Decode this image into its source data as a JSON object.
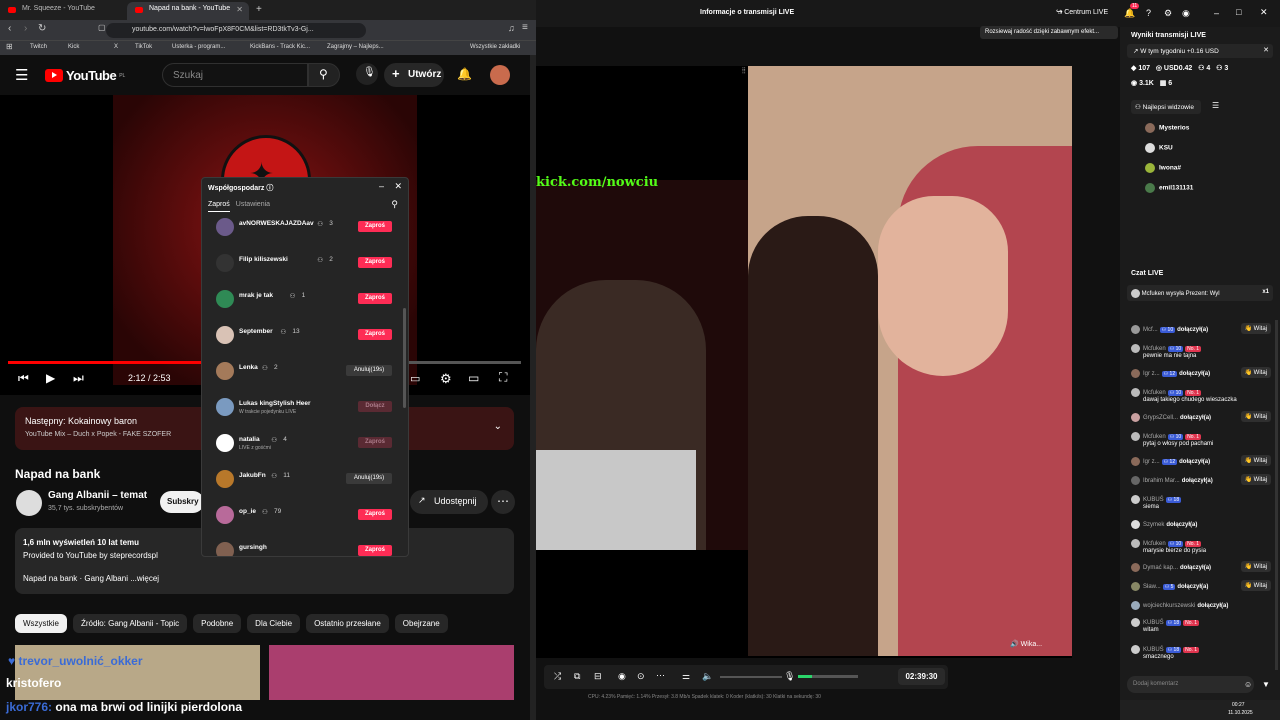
{
  "browser": {
    "tabs": [
      {
        "title": "Mr. Squeeze - YouTube",
        "active": false
      },
      {
        "title": "Napad na bank - YouTube",
        "active": true
      }
    ],
    "url": "youtube.com/watch?v=lwoFpX8F0CM&list=RD3tkTv3-Gj...",
    "bookmarks": [
      "Twitch",
      "Kick",
      "X",
      "TikTok",
      "Usterka - program...",
      "KickBans - Track Kic...",
      "Zagrajmy – Najleps...",
      "Wszystkie zakładki"
    ]
  },
  "youtube": {
    "logo": "YouTube",
    "logo_region": "PL",
    "search_placeholder": "Szukaj",
    "create_label": "Utwórz",
    "timecode": "2:12 / 2:53",
    "progress_fraction": 0.76,
    "next_up_title": "Następny: Kokainowy baron",
    "next_up_sub": "YouTube Mix – Duch x Popek - FAKE SZOFER",
    "video_title": "Napad na bank",
    "channel_name": "Gang Albanii – temat",
    "subscribers": "35,7 tys. subskrybentów",
    "subscribe_label": "Subskry",
    "share_label": "Udostępnij",
    "more_label": "⋯",
    "desc_line1": "1,6 mln wyświetleń  10 lat temu",
    "desc_line2": "Provided to YouTube by steprecordspl",
    "desc_line3": "Napad na bank · Gang Albani ...więcej",
    "chips": [
      "Wszystkie",
      "Źródło: Gang Albanii - Topic",
      "Podobne",
      "Dla Ciebie",
      "Ostatnio przesłane",
      "Obejrzane"
    ]
  },
  "cohost": {
    "title": "Współgospodarz ⓘ",
    "tab_invite": "Zaproś",
    "tab_settings": "Ustawienia",
    "rows": [
      {
        "name": "avNORWESKAJAZDAav",
        "count": "3",
        "sub": "",
        "button": "Zaproś",
        "style": "red"
      },
      {
        "name": "Filip kiliszewski",
        "count": "2",
        "sub": "",
        "button": "Zaproś",
        "style": "red"
      },
      {
        "name": "mrak je tak",
        "count": "1",
        "sub": "",
        "button": "Zaproś",
        "style": "red"
      },
      {
        "name": "September",
        "count": "13",
        "sub": "",
        "button": "Zaproś",
        "style": "red"
      },
      {
        "name": "Lenka",
        "count": "2",
        "sub": "",
        "button": "Anuluj(19s)",
        "style": "gray"
      },
      {
        "name": "Lukas kingStylish Heer",
        "count": "",
        "sub": "W trakcie pojedynku LIVE",
        "button": "Dołącz",
        "style": "dim"
      },
      {
        "name": "natalia",
        "count": "4",
        "sub": "LIVE z gośćmi",
        "button": "Zaproś",
        "style": "dim"
      },
      {
        "name": "JakubFn",
        "count": "11",
        "sub": "",
        "button": "Anuluj(19s)",
        "style": "gray"
      },
      {
        "name": "op_ie",
        "count": "79",
        "sub": "",
        "button": "Zaproś",
        "style": "red"
      },
      {
        "name": "gursingh",
        "count": "",
        "sub": "",
        "button": "Zaproś",
        "style": "red"
      }
    ]
  },
  "live": {
    "header_title": "Informacje o transmisji LIVE",
    "centrum": "Centrum LIVE",
    "notif_count": "11",
    "gift_banner": "Rozsiewaj radość dzięki zabawnym efekt...",
    "kick_overlay": "kick.com/nowciu",
    "time": "02:39:30",
    "overlay_name": "Wika...",
    "stats": "CPU: 4.23%   Pamięć: 1.14%   Przesył: 3.8 Mb/s   Spadek klatek: 0   Koder (klatki/s): 30   Klatki na sekundę: 30"
  },
  "results": {
    "title": "Wyniki transmisji LIVE",
    "week": "W tym tygodniu +0.16 USD",
    "stat_coins": "107",
    "stat_usd": "USD0.42",
    "stat_users": "4",
    "stat_follows": "3",
    "stat_viewers": "3.1K",
    "stat_gifts": "6",
    "top_viewers_label": "Najlepsi widzowie",
    "top_viewers": [
      "Mysterios",
      "KSU",
      "Iwona#",
      "emil131131"
    ]
  },
  "chat": {
    "title": "Czat LIVE",
    "gift_line": "Mcfuken wysyła Prezent: Wyl",
    "gift_count": "x1",
    "messages": [
      {
        "user": "Mcf...",
        "lvl": "10",
        "fan": "",
        "text": "dołączył(a)",
        "welcome": true
      },
      {
        "user": "Mcfuken",
        "lvl": "10",
        "fan": "No. 1",
        "text": "pewnie ma nie tajna",
        "welcome": false
      },
      {
        "user": "Igr z...",
        "lvl": "12",
        "fan": "",
        "text": "dołączył(a)",
        "welcome": true
      },
      {
        "user": "Mcfuken",
        "lvl": "10",
        "fan": "No. 1",
        "text": "dawaj takiego chudego wieszaczka",
        "welcome": false
      },
      {
        "user": "GrypsZCell...",
        "lvl": "",
        "fan": "",
        "text": "dołączył(a)",
        "welcome": true
      },
      {
        "user": "Mcfuken",
        "lvl": "10",
        "fan": "No. 1",
        "text": "pytaj o włosy pod pachami",
        "welcome": false
      },
      {
        "user": "Igr z...",
        "lvl": "12",
        "fan": "",
        "text": "dołączył(a)",
        "welcome": true
      },
      {
        "user": "Ibrahim Mar...",
        "lvl": "",
        "fan": "",
        "text": "dołączył(a)",
        "welcome": true
      },
      {
        "user": "KUBUŚ",
        "lvl": "18",
        "fan": "",
        "text": "siema",
        "welcome": false
      },
      {
        "user": "Szymek",
        "lvl": "",
        "fan": "",
        "text": "dołączył(a)",
        "welcome": false
      },
      {
        "user": "Mcfuken",
        "lvl": "10",
        "fan": "No. 1",
        "text": "marysie bierze do pysia",
        "welcome": false
      },
      {
        "user": "Dymać kap...",
        "lvl": "",
        "fan": "",
        "text": "dołączył(a)",
        "welcome": true
      },
      {
        "user": "Sław...",
        "lvl": "5",
        "fan": "",
        "text": "dołączył(a)",
        "welcome": true
      },
      {
        "user": "wojciechkurszewski",
        "lvl": "",
        "fan": "",
        "text": "dołączył(a)",
        "welcome": false
      },
      {
        "user": "KUBUŚ",
        "lvl": "18",
        "fan": "No. 1",
        "text": "witam",
        "welcome": false
      },
      {
        "user": "KUBUŚ",
        "lvl": "18",
        "fan": "No. 1",
        "text": "smacznego",
        "welcome": false
      }
    ],
    "welcome_label": "Witaj",
    "comment_placeholder": "Dodaj komentarz"
  },
  "overlay_chat": {
    "line1": "trevor_uwolnić_okker",
    "line2": "kristofero",
    "line3_user": "jkor776:",
    "line3_text": "ona ma brwi od linijki pierdolona"
  },
  "taskbar": {
    "time": "00:27",
    "date": "11.10.2025"
  },
  "colors": {
    "youtube_red": "#ff0000",
    "tiktok_red": "#fe2c55",
    "kick_green": "#53fc18"
  }
}
